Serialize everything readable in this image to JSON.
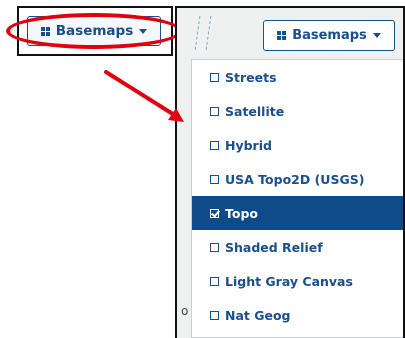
{
  "left_button": {
    "label": "Basemaps",
    "icon": "grid-icon"
  },
  "right_button": {
    "label": "Basemaps",
    "icon": "grid-icon"
  },
  "menu": {
    "items": [
      {
        "label": "Streets",
        "checked": false
      },
      {
        "label": "Satellite",
        "checked": false
      },
      {
        "label": "Hybrid",
        "checked": false
      },
      {
        "label": "USA Topo2D (USGS)",
        "checked": false
      },
      {
        "label": "Topo",
        "checked": true
      },
      {
        "label": "Shaded Relief",
        "checked": false
      },
      {
        "label": "Light Gray Canvas",
        "checked": false
      },
      {
        "label": "Nat Geog",
        "checked": false
      }
    ]
  },
  "map_text": "o",
  "colors": {
    "accent": "#1a4f8c",
    "selected_bg": "#0f4a89",
    "highlight": "#e00010"
  }
}
